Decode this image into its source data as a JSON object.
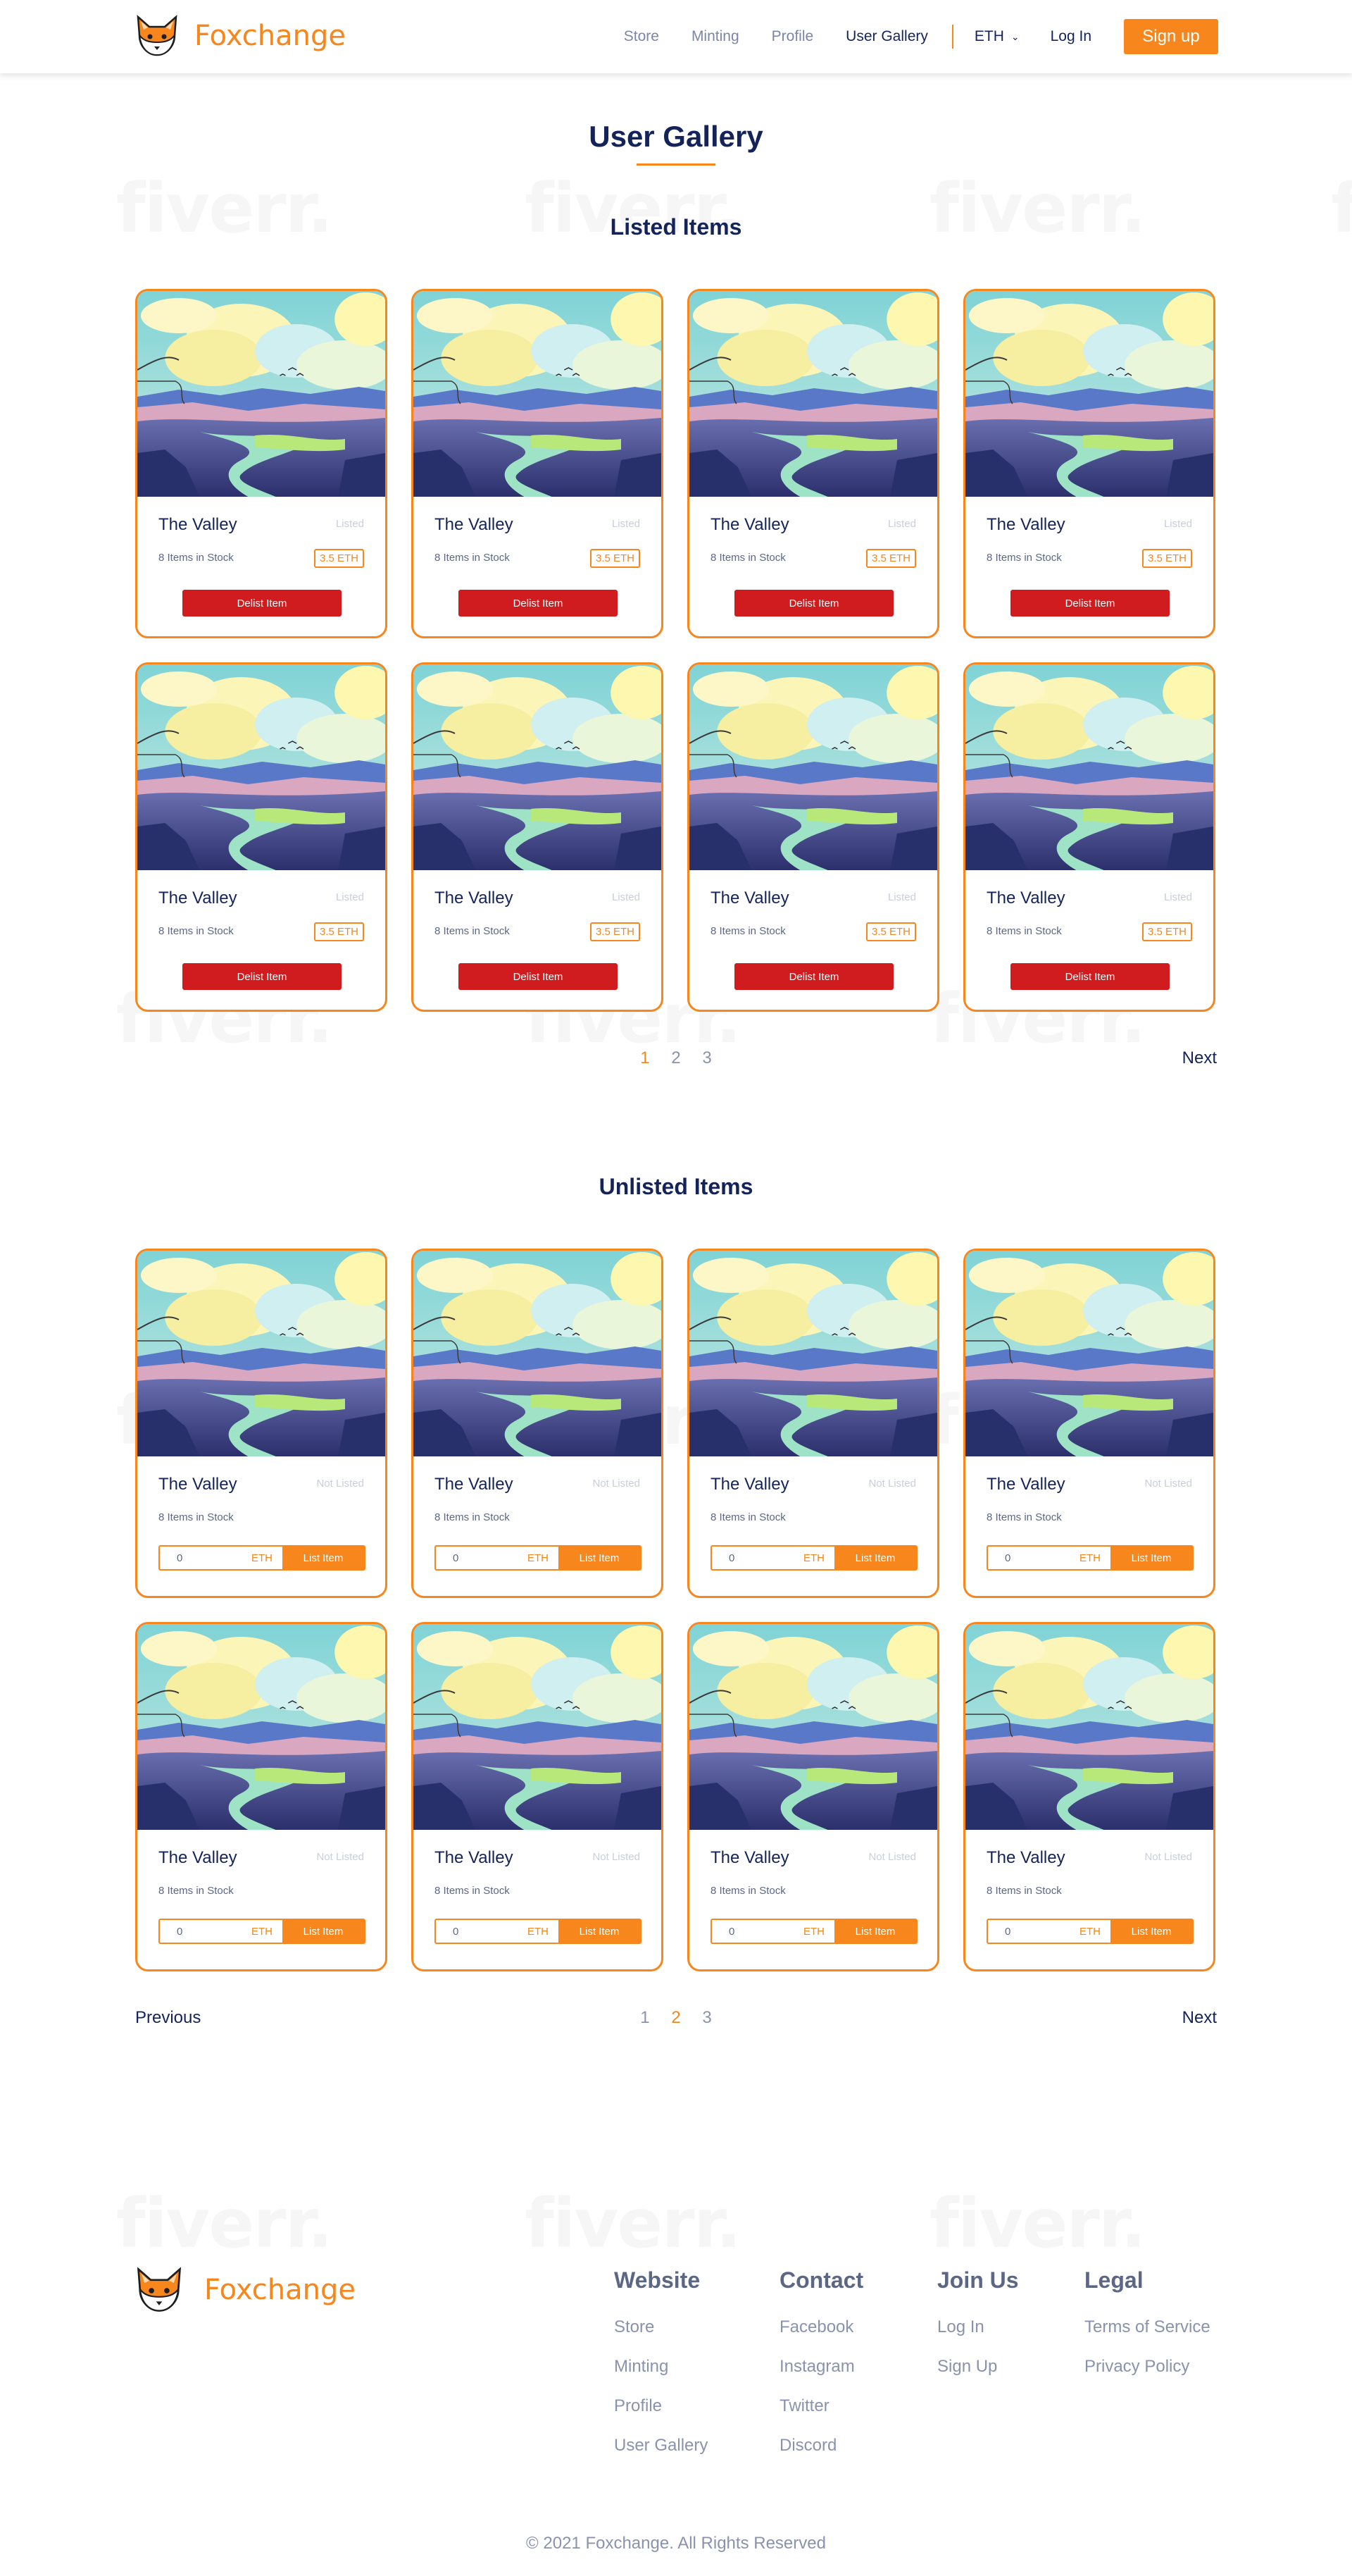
{
  "header": {
    "brand": "Foxchange",
    "nav": [
      {
        "label": "Store",
        "active": false
      },
      {
        "label": "Minting",
        "active": false
      },
      {
        "label": "Profile",
        "active": false
      },
      {
        "label": "User Gallery",
        "active": true
      }
    ],
    "currency": "ETH",
    "login": "Log In",
    "signup": "Sign up"
  },
  "page_title": "User Gallery",
  "listed": {
    "title": "Listed Items",
    "items": [
      {
        "name": "The Valley",
        "status": "Listed",
        "stock": "8 Items in Stock",
        "price": "3.5 ETH",
        "action": "Delist Item"
      },
      {
        "name": "The Valley",
        "status": "Listed",
        "stock": "8 Items in Stock",
        "price": "3.5 ETH",
        "action": "Delist Item"
      },
      {
        "name": "The Valley",
        "status": "Listed",
        "stock": "8 Items in Stock",
        "price": "3.5 ETH",
        "action": "Delist Item"
      },
      {
        "name": "The Valley",
        "status": "Listed",
        "stock": "8 Items in Stock",
        "price": "3.5 ETH",
        "action": "Delist Item"
      },
      {
        "name": "The Valley",
        "status": "Listed",
        "stock": "8 Items in Stock",
        "price": "3.5 ETH",
        "action": "Delist Item"
      },
      {
        "name": "The Valley",
        "status": "Listed",
        "stock": "8 Items in Stock",
        "price": "3.5 ETH",
        "action": "Delist Item"
      },
      {
        "name": "The Valley",
        "status": "Listed",
        "stock": "8 Items in Stock",
        "price": "3.5 ETH",
        "action": "Delist Item"
      },
      {
        "name": "The Valley",
        "status": "Listed",
        "stock": "8 Items in Stock",
        "price": "3.5 ETH",
        "action": "Delist Item"
      }
    ],
    "pagination": {
      "pages": [
        "1",
        "2",
        "3"
      ],
      "current": "1",
      "next": "Next"
    }
  },
  "unlisted": {
    "title": "Unlisted Items",
    "items": [
      {
        "name": "The Valley",
        "status": "Not Listed",
        "stock": "8 Items in Stock",
        "amount": "0",
        "unit": "ETH",
        "action": "List Item"
      },
      {
        "name": "The Valley",
        "status": "Not Listed",
        "stock": "8 Items in Stock",
        "amount": "0",
        "unit": "ETH",
        "action": "List Item"
      },
      {
        "name": "The Valley",
        "status": "Not Listed",
        "stock": "8 Items in Stock",
        "amount": "0",
        "unit": "ETH",
        "action": "List Item"
      },
      {
        "name": "The Valley",
        "status": "Not Listed",
        "stock": "8 Items in Stock",
        "amount": "0",
        "unit": "ETH",
        "action": "List Item"
      },
      {
        "name": "The Valley",
        "status": "Not Listed",
        "stock": "8 Items in Stock",
        "amount": "0",
        "unit": "ETH",
        "action": "List Item"
      },
      {
        "name": "The Valley",
        "status": "Not Listed",
        "stock": "8 Items in Stock",
        "amount": "0",
        "unit": "ETH",
        "action": "List Item"
      },
      {
        "name": "The Valley",
        "status": "Not Listed",
        "stock": "8 Items in Stock",
        "amount": "0",
        "unit": "ETH",
        "action": "List Item"
      },
      {
        "name": "The Valley",
        "status": "Not Listed",
        "stock": "8 Items in Stock",
        "amount": "0",
        "unit": "ETH",
        "action": "List Item"
      }
    ],
    "pagination": {
      "previous": "Previous",
      "pages": [
        "1",
        "2",
        "3"
      ],
      "current": "2",
      "next": "Next"
    }
  },
  "watermark": "fiverr.",
  "footer": {
    "brand": "Foxchange",
    "columns": [
      {
        "title": "Website",
        "links": [
          "Store",
          "Minting",
          "Profile",
          "User Gallery"
        ]
      },
      {
        "title": "Contact",
        "links": [
          "Facebook",
          "Instagram",
          "Twitter",
          "Discord"
        ]
      },
      {
        "title": "Join Us",
        "links": [
          "Log In",
          "Sign Up"
        ]
      },
      {
        "title": "Legal",
        "links": [
          "Terms of Service",
          "Privacy Policy"
        ]
      }
    ],
    "copyright": "© 2021 Foxchange. All Rights Reserved"
  },
  "colors": {
    "accent": "#f7861c",
    "navy": "#14245a",
    "danger": "#d01c1f",
    "muted": "#8a93ad"
  },
  "icons": {
    "logo": "fox-logo-icon",
    "dropdown": "chevron-down-icon"
  }
}
